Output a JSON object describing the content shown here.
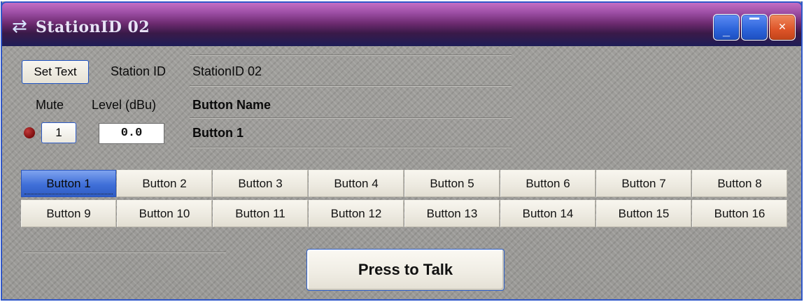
{
  "window": {
    "title": "StationID 02",
    "controls": {
      "minimize_glyph": "_",
      "maximize_glyph": "▔",
      "close_glyph": "✕"
    },
    "colors": {
      "frame": "#2f57c9",
      "title_gradient_top": "#c46fc4",
      "title_gradient_bottom": "#1e1d57",
      "close_button": "#dd5428",
      "active_button": "#3f6fd8"
    }
  },
  "header": {
    "set_text_label": "Set Text",
    "station_id_label": "Station ID",
    "station_id_value": "StationID 02"
  },
  "controls": {
    "mute_label": "Mute",
    "level_label": "Level (dBu)",
    "button_name_label": "Button Name",
    "mute_value": "1",
    "level_value": "0.0",
    "button_name_value": "Button 1",
    "led_icon": "red-led-icon"
  },
  "buttons": {
    "active_index": 0,
    "row1": [
      "Button 1",
      "Button 2",
      "Button 3",
      "Button 4",
      "Button 5",
      "Button 6",
      "Button 7",
      "Button 8"
    ],
    "row2": [
      "Button 9",
      "Button 10",
      "Button 11",
      "Button 12",
      "Button 13",
      "Button 14",
      "Button 15",
      "Button 16"
    ]
  },
  "talk": {
    "label": "Press to Talk"
  }
}
